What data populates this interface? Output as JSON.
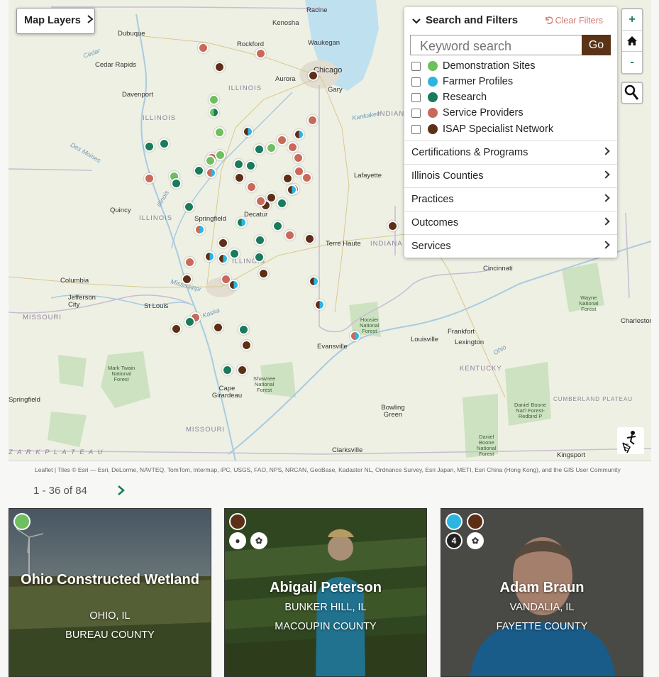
{
  "map": {
    "layers_button": "Map Layers",
    "zoom_in": "+",
    "zoom_out": "-",
    "cities": [
      {
        "name": "Racine"
      },
      {
        "name": "Kenosha"
      },
      {
        "name": "Waukegan"
      },
      {
        "name": "Dubuque"
      },
      {
        "name": "Rockford"
      },
      {
        "name": "Cedar Rapids"
      },
      {
        "name": "Aurora"
      },
      {
        "name": "Chicago"
      },
      {
        "name": "Gary"
      },
      {
        "name": "Davenport"
      },
      {
        "name": "Lafayette"
      },
      {
        "name": "Quincy"
      },
      {
        "name": "Springfield"
      },
      {
        "name": "Decatur"
      },
      {
        "name": "Terre Haute"
      },
      {
        "name": "Cincinnati"
      },
      {
        "name": "Columbia"
      },
      {
        "name": "Jefferson City"
      },
      {
        "name": "St Louis"
      },
      {
        "name": "Charleston"
      },
      {
        "name": "Frankfort"
      },
      {
        "name": "Louisville"
      },
      {
        "name": "Lexington"
      },
      {
        "name": "Evansville"
      },
      {
        "name": "Springfield"
      },
      {
        "name": "Cape Girardeau"
      },
      {
        "name": "Bowling Green"
      },
      {
        "name": "Clarksville"
      },
      {
        "name": "Kingsport"
      }
    ],
    "states": [
      {
        "name": "ILLINOIS"
      },
      {
        "name": "ILLINOIS"
      },
      {
        "name": "ILLINOIS"
      },
      {
        "name": "ILLINOIS"
      },
      {
        "name": "INDIANA"
      },
      {
        "name": "INDIANA"
      },
      {
        "name": "MISSOURI"
      },
      {
        "name": "MISSOURI"
      },
      {
        "name": "KENTUCKY"
      },
      {
        "name": "Z A R K   P L A T E A U"
      },
      {
        "name": "CUMBERLAND PLATEAU"
      }
    ],
    "waters": [
      {
        "name": "Cedar"
      },
      {
        "name": "Des Moines"
      },
      {
        "name": "Kankakee"
      },
      {
        "name": "Mississippi"
      },
      {
        "name": "Kaska"
      },
      {
        "name": "Ohio"
      },
      {
        "name": "Illinois"
      }
    ],
    "forests": [
      {
        "name": "Hoosier\nNational\nForest"
      },
      {
        "name": "Mark Twain\nNational\nForest"
      },
      {
        "name": "Shawnee\nNational\nForest"
      },
      {
        "name": "Daniel Boone\nNat'l Forest-\nRedbird P"
      },
      {
        "name": "Daniel\nBoone\nNational\nForest"
      },
      {
        "name": "Wayne\nNational\nForest"
      }
    ],
    "markers": [
      {
        "c1": "#c8695a"
      },
      {
        "c1": "#c8695a"
      },
      {
        "c1": "#5e2f17"
      },
      {
        "c1": "#5e2f17"
      },
      {
        "c1": "#6fbf5f"
      },
      {
        "c1": "#6fbf5f",
        "c2": "#1a7a5c"
      },
      {
        "c1": "#6fbf5f"
      },
      {
        "c1": "#c8695a"
      },
      {
        "c1": "#5e2f17",
        "c2": "#2cb5e0"
      },
      {
        "c1": "#1a7a5c"
      },
      {
        "c1": "#1a7a5c"
      },
      {
        "c1": "#c8695a"
      },
      {
        "c1": "#6fbf5f"
      },
      {
        "c1": "#1a7a5c"
      },
      {
        "c1": "#5e2f17",
        "c2": "#2cb5e0"
      },
      {
        "c1": "#c8695a"
      },
      {
        "c1": "#1a7a5c"
      },
      {
        "c1": "#c8695a"
      },
      {
        "c1": "#1a7a5c"
      },
      {
        "c1": "#6fbf5f"
      },
      {
        "c1": "#c8695a"
      },
      {
        "c1": "#c8695a"
      },
      {
        "c1": "#c8695a"
      },
      {
        "c1": "#6fbf5f"
      },
      {
        "c1": "#1a7a5c"
      },
      {
        "c1": "#6fbf5f"
      },
      {
        "c1": "#1a7a5c"
      },
      {
        "c1": "#c8695a",
        "c2": "#2cb5e0"
      },
      {
        "c1": "#1a7a5c"
      },
      {
        "c1": "#5e2f17"
      },
      {
        "c1": "#c8695a"
      },
      {
        "c1": "#5e2f17"
      },
      {
        "c1": "#c8695a"
      },
      {
        "c1": "#5e2f17",
        "c2": "#2cb5e0"
      },
      {
        "c1": "#5e2f17"
      },
      {
        "c1": "#5e2f17"
      },
      {
        "c1": "#c8695a"
      },
      {
        "c1": "#1a7a5c"
      },
      {
        "c1": "#1a7a5c"
      },
      {
        "c1": "#c8695a",
        "c2": "#2cb5e0"
      },
      {
        "c1": "#1a7a5c",
        "c2": "#2cb5e0"
      },
      {
        "c1": "#1a7a5c"
      },
      {
        "c1": "#c8695a"
      },
      {
        "c1": "#5e2f17"
      },
      {
        "c1": "#5e2f17"
      },
      {
        "c1": "#5e2f17",
        "c2": "#2cb5e0"
      },
      {
        "c1": "#1a7a5c"
      },
      {
        "c1": "#1a7a5c"
      },
      {
        "c1": "#c8695a"
      },
      {
        "c1": "#5e2f17"
      },
      {
        "c1": "#5e2f17",
        "c2": "#2cb5e0"
      },
      {
        "c1": "#c8695a"
      },
      {
        "c1": "#5e2f17"
      },
      {
        "c1": "#5e2f17",
        "c2": "#2cb5e0"
      },
      {
        "c1": "#c8695a"
      },
      {
        "c1": "#1a7a5c"
      },
      {
        "c1": "#5e2f17"
      },
      {
        "c1": "#5e2f17"
      },
      {
        "c1": "#1a7a5c"
      },
      {
        "c1": "#5e2f17"
      },
      {
        "c1": "#1a7a5c"
      },
      {
        "c1": "#5e2f17"
      },
      {
        "c1": "#c8695a",
        "c2": "#2cb5e0"
      },
      {
        "c1": "#5e2f17",
        "c2": "#2cb5e0"
      },
      {
        "c1": "#5e2f17",
        "c2": "#2cb5e0"
      },
      {
        "c1": "#5e2f17"
      },
      {
        "c1": "#c8695a"
      }
    ]
  },
  "filters": {
    "title": "Search and Filters",
    "clear": "Clear Filters",
    "search_placeholder": "Keyword search",
    "go": "Go",
    "categories": [
      {
        "label": "Demonstration Sites",
        "color": "#6fbf5f"
      },
      {
        "label": "Farmer Profiles",
        "color": "#2cb5e0"
      },
      {
        "label": "Research",
        "color": "#1a7a5c"
      },
      {
        "label": "Service Providers",
        "color": "#c8695a"
      },
      {
        "label": "ISAP Specialist Network",
        "color": "#5e2f17"
      }
    ],
    "sections": [
      "Certifications & Programs",
      "Illinois Counties",
      "Practices",
      "Outcomes",
      "Services"
    ]
  },
  "attribution": "Leaflet | Tiles © Esri — Esri, DeLorme, NAVTEQ, TomTom, Intermap, iPC, USGS, FAO, NPS, NRCAN, GeoBase, Kadaster NL, Ordnance Survey, Esri Japan, METI, Esri China (Hong Kong), and the GIS User Community",
  "pagination": {
    "text": "1 - 36 of 84"
  },
  "cards": [
    {
      "title": "Ohio Constructed Wetland",
      "city": "OHIO, IL",
      "county": "BUREAU COUNTY"
    },
    {
      "title": "Abigail Peterson",
      "city": "BUNKER HILL, IL",
      "county": "MACOUPIN COUNTY"
    },
    {
      "title": "Adam Braun",
      "city": "VANDALIA, IL",
      "county": "FAYETTE COUNTY"
    }
  ],
  "colors": {
    "demo": "#6fbf5f",
    "farmer": "#2cb5e0",
    "research": "#1a7a5c",
    "provider": "#c8695a",
    "isap": "#5e2f17"
  }
}
